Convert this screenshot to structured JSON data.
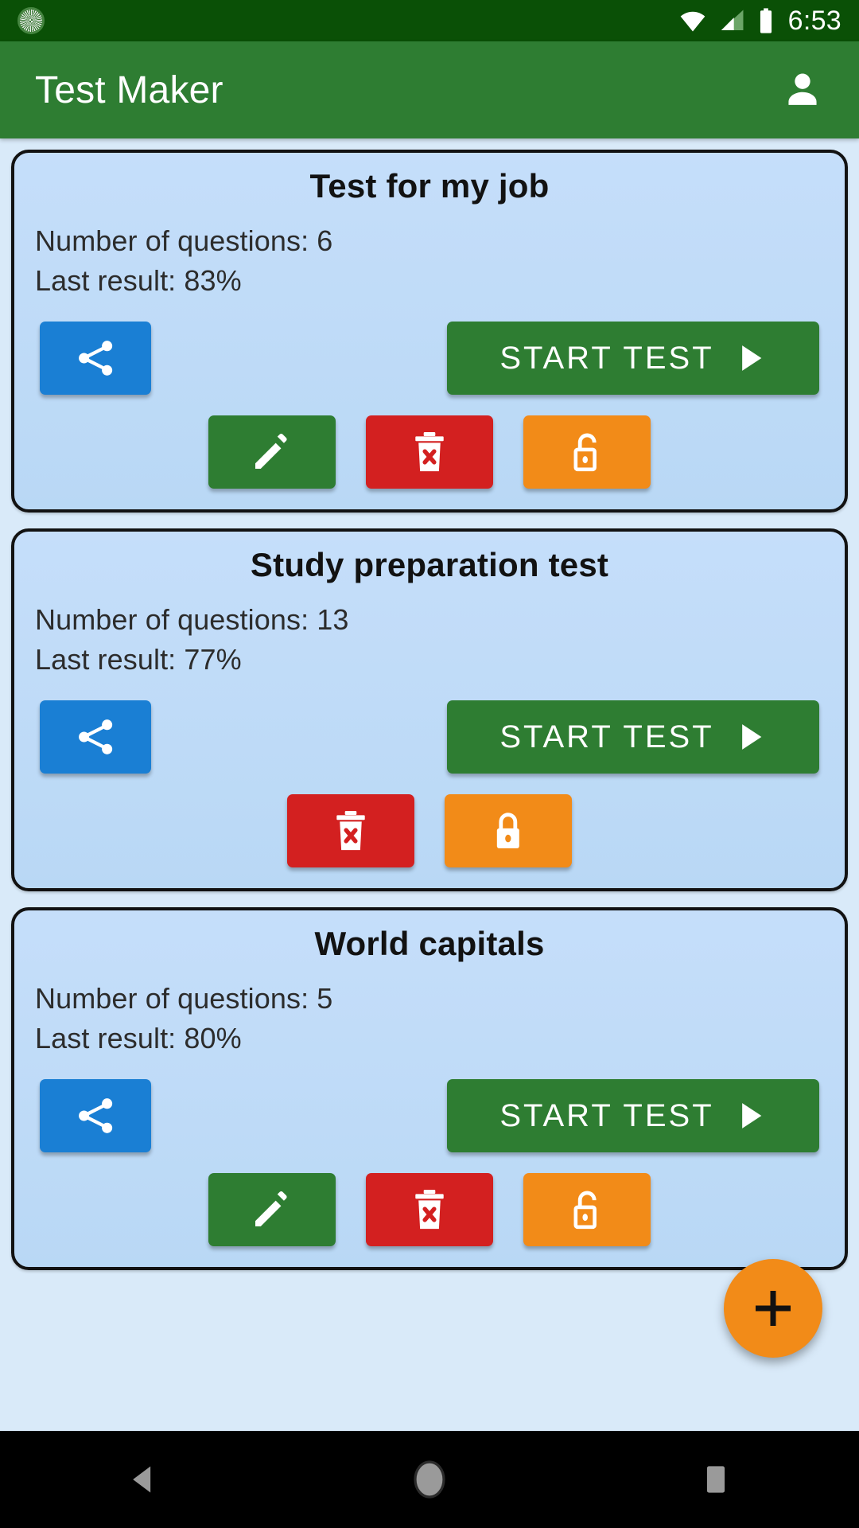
{
  "status_bar": {
    "time": "6:53",
    "icons": [
      "sync-icon",
      "wifi-icon",
      "signal-icon",
      "battery-icon"
    ]
  },
  "app_bar": {
    "title": "Test Maker",
    "account_icon": "account-icon"
  },
  "colors": {
    "status_bar": "#0a5006",
    "app_bar": "#2e7d32",
    "background": "#d9eaf9",
    "card": "#c5defa",
    "card_border": "#121212",
    "share": "#1a7fd4",
    "start": "#2e7d32",
    "edit": "#2e7d32",
    "delete": "#d32020",
    "lock": "#f28b18",
    "fab": "#f28b18"
  },
  "labels": {
    "questions_prefix": "Number of questions:",
    "result_prefix": "Last result:",
    "start_test": "START TEST"
  },
  "cards": [
    {
      "title": "Test for my job",
      "questions_line": "Number of questions: 6",
      "result_line": "Last result:  83%",
      "question_count": "6",
      "last_result": "83%",
      "start_label": "START TEST",
      "has_edit": true,
      "locked": false,
      "lock_icon": "unlock-icon"
    },
    {
      "title": "Study preparation test",
      "questions_line": "Number of questions: 13",
      "result_line": "Last result:  77%",
      "question_count": "13",
      "last_result": "77%",
      "start_label": "START TEST",
      "has_edit": false,
      "locked": true,
      "lock_icon": "lock-icon"
    },
    {
      "title": "World capitals",
      "questions_line": "Number of questions: 5",
      "result_line": "Last result:  80%",
      "question_count": "5",
      "last_result": "80%",
      "start_label": "START TEST",
      "has_edit": true,
      "locked": false,
      "lock_icon": "unlock-icon"
    }
  ],
  "fab": {
    "icon": "plus-icon"
  },
  "nav_bar": {
    "back": "back-icon",
    "home": "home-icon",
    "recents": "recents-icon"
  }
}
